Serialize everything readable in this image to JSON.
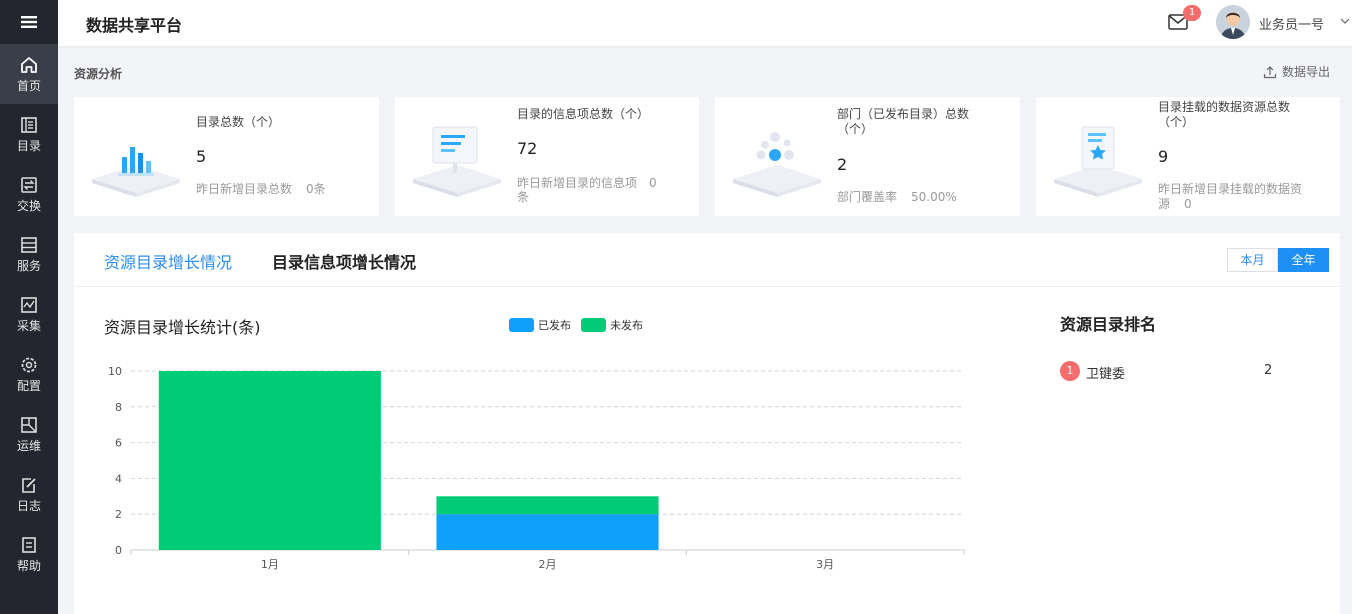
{
  "app": {
    "title": "数据共享平台"
  },
  "header": {
    "mail_badge": "1",
    "user_name": "业务员一号"
  },
  "sidebar": {
    "items": [
      {
        "label": "首页",
        "icon": "home-icon"
      },
      {
        "label": "目录",
        "icon": "catalog-icon"
      },
      {
        "label": "交换",
        "icon": "exchange-icon"
      },
      {
        "label": "服务",
        "icon": "service-icon"
      },
      {
        "label": "采集",
        "icon": "collect-icon"
      },
      {
        "label": "配置",
        "icon": "gear-icon"
      },
      {
        "label": "运维",
        "icon": "ops-icon"
      },
      {
        "label": "日志",
        "icon": "log-icon"
      },
      {
        "label": "帮助",
        "icon": "help-icon"
      }
    ]
  },
  "analysis": {
    "title": "资源分析",
    "export_label": "数据导出",
    "cards": [
      {
        "title": "目录总数（个）",
        "value": "5",
        "sub_label": "昨日新增目录总数",
        "sub_value": "0条"
      },
      {
        "title": "目录的信息项总数（个）",
        "value": "72",
        "sub_label": "昨日新增目录的信息项",
        "sub_value": "0",
        "sub_tail": "条"
      },
      {
        "title": "部门（已发布目录）总数",
        "title2": "（个）",
        "value": "2",
        "sub_label": "部门覆盖率",
        "sub_value": "50.00%"
      },
      {
        "title": "目录挂载的数据资源总数",
        "title2": "（个）",
        "value": "9",
        "sub_label": "昨日新增目录挂载的数据资",
        "sub_label2": "源",
        "sub_value": "0"
      }
    ]
  },
  "tabs": [
    {
      "label": "资源目录增长情况",
      "active": true
    },
    {
      "label": "目录信息项增长情况",
      "active": false
    }
  ],
  "period": {
    "options": [
      "本月",
      "全年"
    ],
    "selected": "全年"
  },
  "chart_title": "资源目录增长统计(条)",
  "chart_data": {
    "type": "bar",
    "stacked": true,
    "categories": [
      "1月",
      "2月",
      "3月"
    ],
    "series": [
      {
        "name": "已发布",
        "values": [
          0,
          2,
          0
        ],
        "color": "#0ea0fb"
      },
      {
        "name": "未发布",
        "values": [
          10,
          1,
          0
        ],
        "color": "#00cc78"
      }
    ],
    "yticks": [
      0,
      2,
      4,
      6,
      8,
      10
    ],
    "ylim": [
      0,
      10
    ],
    "grid": true,
    "legend_position": "top"
  },
  "ranking": {
    "title": "资源目录排名",
    "items": [
      {
        "rank": "1",
        "name": "卫键委",
        "value": "2"
      }
    ]
  }
}
